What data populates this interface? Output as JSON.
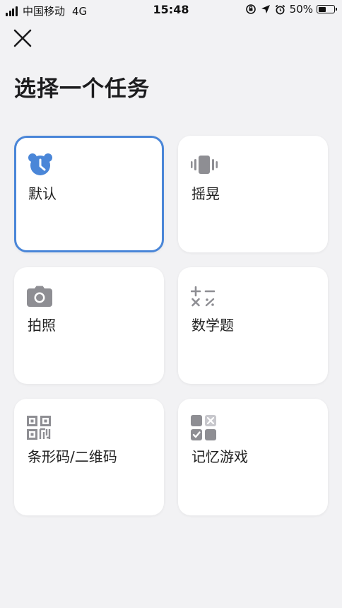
{
  "status_bar": {
    "carrier": "中国移动",
    "network": "4G",
    "time": "15:48",
    "battery": "50%",
    "battery_level": 0.5
  },
  "page": {
    "title": "选择一个任务"
  },
  "tasks": [
    {
      "label": "默认",
      "icon": "alarm-clock-icon",
      "selected": true
    },
    {
      "label": "摇晃",
      "icon": "vibrate-phone-icon",
      "selected": false
    },
    {
      "label": "拍照",
      "icon": "camera-icon",
      "selected": false
    },
    {
      "label": "数学题",
      "icon": "math-operators-icon",
      "selected": false
    },
    {
      "label": "条形码/二维码",
      "icon": "qr-code-icon",
      "selected": false
    },
    {
      "label": "记忆游戏",
      "icon": "memory-grid-icon",
      "selected": false
    }
  ],
  "colors": {
    "accent": "#4a86d8",
    "icon_gray": "#8e8e93",
    "background": "#f2f2f4",
    "card": "#ffffff"
  }
}
